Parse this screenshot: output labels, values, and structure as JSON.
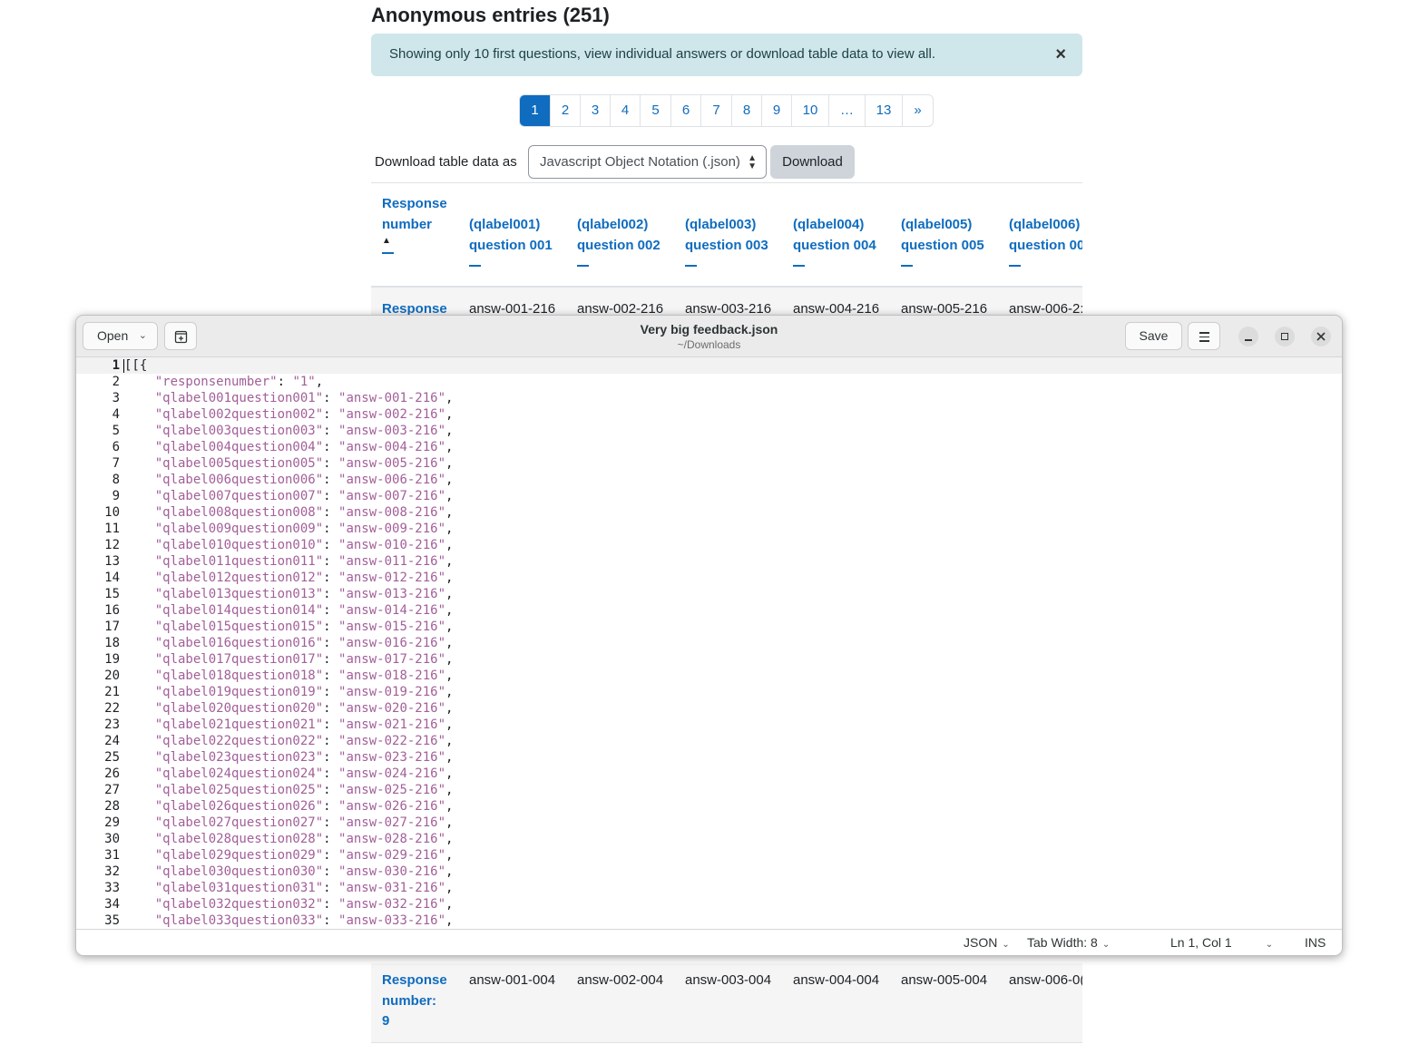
{
  "page": {
    "title": "Anonymous entries (251)",
    "alert_text": "Showing only 10 first questions, view individual answers or download table data to view all.",
    "alert_close": "×",
    "pagination": [
      "1",
      "2",
      "3",
      "4",
      "5",
      "6",
      "7",
      "8",
      "9",
      "10",
      "…",
      "13",
      "»"
    ],
    "active_page": "1",
    "download_label": "Download table data as",
    "download_format": "Javascript Object Notation (.json)",
    "download_button": "Download",
    "columns": [
      {
        "line1": "Response",
        "line2": "number",
        "sorted": true
      },
      {
        "line1": "(qlabel001)",
        "line2": "question 001"
      },
      {
        "line1": "(qlabel002)",
        "line2": "question 002"
      },
      {
        "line1": "(qlabel003)",
        "line2": "question 003"
      },
      {
        "line1": "(qlabel004)",
        "line2": "question 004"
      },
      {
        "line1": "(qlabel005)",
        "line2": "question 005"
      },
      {
        "line1": "(qlabel006)",
        "line2": "question 00"
      }
    ],
    "sort_indicator": "▲",
    "row_first": {
      "label": "Response",
      "cells": [
        "answ-001-216",
        "answ-002-216",
        "answ-003-216",
        "answ-004-216",
        "answ-005-216",
        "answ-006-2:"
      ]
    },
    "row_last": {
      "label_1": "Response",
      "label_2": "number:",
      "label_3": "9",
      "cells": [
        "answ-001-004",
        "answ-002-004",
        "answ-003-004",
        "answ-004-004",
        "answ-005-004",
        "answ-006-0("
      ]
    }
  },
  "editor": {
    "open_label": "Open",
    "title": "Very big feedback.json",
    "subtitle": "~/Downloads",
    "save_label": "Save",
    "lines": [
      {
        "n": "1",
        "text": "[[{"
      },
      {
        "n": "2",
        "key": "\"responsenumber\"",
        "val": "\"1\""
      },
      {
        "n": "3",
        "key": "\"qlabel001question001\"",
        "val": "\"answ-001-216\""
      },
      {
        "n": "4",
        "key": "\"qlabel002question002\"",
        "val": "\"answ-002-216\""
      },
      {
        "n": "5",
        "key": "\"qlabel003question003\"",
        "val": "\"answ-003-216\""
      },
      {
        "n": "6",
        "key": "\"qlabel004question004\"",
        "val": "\"answ-004-216\""
      },
      {
        "n": "7",
        "key": "\"qlabel005question005\"",
        "val": "\"answ-005-216\""
      },
      {
        "n": "8",
        "key": "\"qlabel006question006\"",
        "val": "\"answ-006-216\""
      },
      {
        "n": "9",
        "key": "\"qlabel007question007\"",
        "val": "\"answ-007-216\""
      },
      {
        "n": "10",
        "key": "\"qlabel008question008\"",
        "val": "\"answ-008-216\""
      },
      {
        "n": "11",
        "key": "\"qlabel009question009\"",
        "val": "\"answ-009-216\""
      },
      {
        "n": "12",
        "key": "\"qlabel010question010\"",
        "val": "\"answ-010-216\""
      },
      {
        "n": "13",
        "key": "\"qlabel011question011\"",
        "val": "\"answ-011-216\""
      },
      {
        "n": "14",
        "key": "\"qlabel012question012\"",
        "val": "\"answ-012-216\""
      },
      {
        "n": "15",
        "key": "\"qlabel013question013\"",
        "val": "\"answ-013-216\""
      },
      {
        "n": "16",
        "key": "\"qlabel014question014\"",
        "val": "\"answ-014-216\""
      },
      {
        "n": "17",
        "key": "\"qlabel015question015\"",
        "val": "\"answ-015-216\""
      },
      {
        "n": "18",
        "key": "\"qlabel016question016\"",
        "val": "\"answ-016-216\""
      },
      {
        "n": "19",
        "key": "\"qlabel017question017\"",
        "val": "\"answ-017-216\""
      },
      {
        "n": "20",
        "key": "\"qlabel018question018\"",
        "val": "\"answ-018-216\""
      },
      {
        "n": "21",
        "key": "\"qlabel019question019\"",
        "val": "\"answ-019-216\""
      },
      {
        "n": "22",
        "key": "\"qlabel020question020\"",
        "val": "\"answ-020-216\""
      },
      {
        "n": "23",
        "key": "\"qlabel021question021\"",
        "val": "\"answ-021-216\""
      },
      {
        "n": "24",
        "key": "\"qlabel022question022\"",
        "val": "\"answ-022-216\""
      },
      {
        "n": "25",
        "key": "\"qlabel023question023\"",
        "val": "\"answ-023-216\""
      },
      {
        "n": "26",
        "key": "\"qlabel024question024\"",
        "val": "\"answ-024-216\""
      },
      {
        "n": "27",
        "key": "\"qlabel025question025\"",
        "val": "\"answ-025-216\""
      },
      {
        "n": "28",
        "key": "\"qlabel026question026\"",
        "val": "\"answ-026-216\""
      },
      {
        "n": "29",
        "key": "\"qlabel027question027\"",
        "val": "\"answ-027-216\""
      },
      {
        "n": "30",
        "key": "\"qlabel028question028\"",
        "val": "\"answ-028-216\""
      },
      {
        "n": "31",
        "key": "\"qlabel029question029\"",
        "val": "\"answ-029-216\""
      },
      {
        "n": "32",
        "key": "\"qlabel030question030\"",
        "val": "\"answ-030-216\""
      },
      {
        "n": "33",
        "key": "\"qlabel031question031\"",
        "val": "\"answ-031-216\""
      },
      {
        "n": "34",
        "key": "\"qlabel032question032\"",
        "val": "\"answ-032-216\""
      },
      {
        "n": "35",
        "key": "\"qlabel033question033\"",
        "val": "\"answ-033-216\""
      }
    ],
    "status": {
      "language": "JSON",
      "tab_width": "Tab Width: 8",
      "position": "Ln 1, Col 1",
      "mode": "INS"
    }
  },
  "colors": {
    "link": "#0f6cbf",
    "alert_bg": "#cfe6ea",
    "string": "#a25f99"
  }
}
